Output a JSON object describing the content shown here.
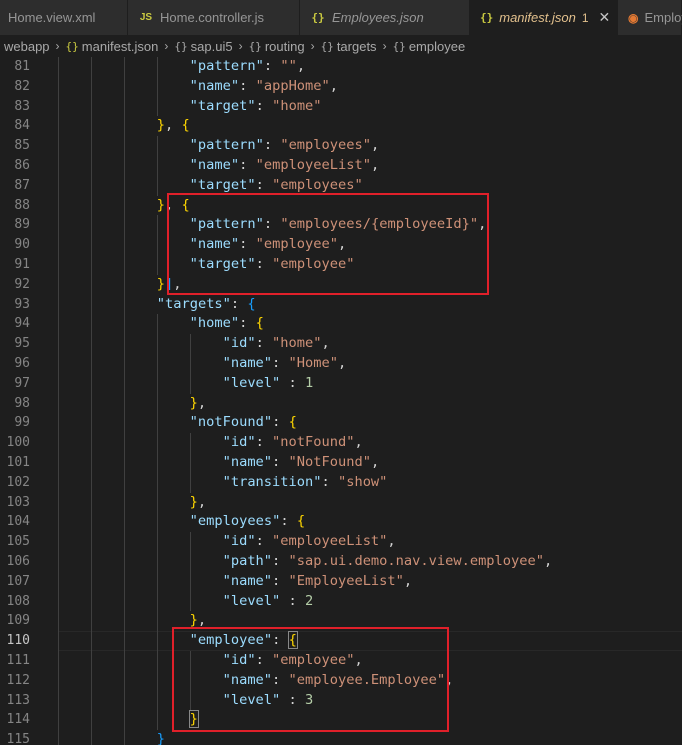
{
  "tabs": [
    {
      "label": "Home.view.xml",
      "icon": "",
      "icon_name": "",
      "active": false,
      "italic": false,
      "badge": "",
      "close": ""
    },
    {
      "label": "Home.controller.js",
      "icon": "JS",
      "icon_name": "js-file-icon",
      "active": false,
      "italic": false,
      "badge": "",
      "close": ""
    },
    {
      "label": "Employees.json",
      "icon": "{}",
      "icon_name": "json-file-icon",
      "active": false,
      "italic": true,
      "badge": "",
      "close": ""
    },
    {
      "label": "manifest.json",
      "icon": "{}",
      "icon_name": "json-file-icon",
      "active": true,
      "italic": true,
      "badge": "1",
      "close": "✕"
    },
    {
      "label": "Employ",
      "icon": "◉",
      "icon_name": "rss-file-icon",
      "active": false,
      "italic": false,
      "badge": "",
      "close": ""
    }
  ],
  "breadcrumb": [
    {
      "label": "webapp",
      "icon": ""
    },
    {
      "label": "manifest.json",
      "icon": "{}"
    },
    {
      "label": "sap.ui5",
      "icon": "{}"
    },
    {
      "label": "routing",
      "icon": "{}"
    },
    {
      "label": "targets",
      "icon": "{}"
    },
    {
      "label": "employee",
      "icon": "{}"
    }
  ],
  "current_line": 110,
  "lines": [
    {
      "n": 81,
      "d": 4,
      "t": [
        [
          "k",
          "\"pattern\""
        ],
        [
          "p",
          ": "
        ],
        [
          "s",
          "\"\""
        ],
        [
          "p",
          ","
        ]
      ]
    },
    {
      "n": 82,
      "d": 4,
      "t": [
        [
          "k",
          "\"name\""
        ],
        [
          "p",
          ": "
        ],
        [
          "s",
          "\"appHome\""
        ],
        [
          "p",
          ","
        ]
      ]
    },
    {
      "n": 83,
      "d": 4,
      "t": [
        [
          "k",
          "\"target\""
        ],
        [
          "p",
          ": "
        ],
        [
          "s",
          "\"home\""
        ]
      ]
    },
    {
      "n": 84,
      "d": 3,
      "t": [
        [
          "b3",
          "}"
        ],
        [
          "p",
          ", "
        ],
        [
          "b3",
          "{"
        ]
      ]
    },
    {
      "n": 85,
      "d": 4,
      "t": [
        [
          "k",
          "\"pattern\""
        ],
        [
          "p",
          ": "
        ],
        [
          "s",
          "\"employees\""
        ],
        [
          "p",
          ","
        ]
      ]
    },
    {
      "n": 86,
      "d": 4,
      "t": [
        [
          "k",
          "\"name\""
        ],
        [
          "p",
          ": "
        ],
        [
          "s",
          "\"employeeList\""
        ],
        [
          "p",
          ","
        ]
      ]
    },
    {
      "n": 87,
      "d": 4,
      "t": [
        [
          "k",
          "\"target\""
        ],
        [
          "p",
          ": "
        ],
        [
          "s",
          "\"employees\""
        ]
      ]
    },
    {
      "n": 88,
      "d": 3,
      "t": [
        [
          "b3",
          "}"
        ],
        [
          "p",
          ", "
        ],
        [
          "b3",
          "{"
        ]
      ]
    },
    {
      "n": 89,
      "d": 4,
      "t": [
        [
          "k",
          "\"pattern\""
        ],
        [
          "p",
          ": "
        ],
        [
          "s",
          "\"employees/{employeeId}\""
        ],
        [
          "p",
          ","
        ]
      ]
    },
    {
      "n": 90,
      "d": 4,
      "t": [
        [
          "k",
          "\"name\""
        ],
        [
          "p",
          ": "
        ],
        [
          "s",
          "\"employee\""
        ],
        [
          "p",
          ","
        ]
      ]
    },
    {
      "n": 91,
      "d": 4,
      "t": [
        [
          "k",
          "\"target\""
        ],
        [
          "p",
          ": "
        ],
        [
          "s",
          "\"employee\""
        ]
      ]
    },
    {
      "n": 92,
      "d": 3,
      "t": [
        [
          "b3",
          "}"
        ],
        [
          "b2",
          "]"
        ],
        [
          "p",
          ","
        ]
      ]
    },
    {
      "n": 93,
      "d": 3,
      "t": [
        [
          "k",
          "\"targets\""
        ],
        [
          "p",
          ": "
        ],
        [
          "b2",
          "{"
        ]
      ]
    },
    {
      "n": 94,
      "d": 4,
      "t": [
        [
          "k",
          "\"home\""
        ],
        [
          "p",
          ": "
        ],
        [
          "b3",
          "{"
        ]
      ]
    },
    {
      "n": 95,
      "d": 5,
      "t": [
        [
          "k",
          "\"id\""
        ],
        [
          "p",
          ": "
        ],
        [
          "s",
          "\"home\""
        ],
        [
          "p",
          ","
        ]
      ]
    },
    {
      "n": 96,
      "d": 5,
      "t": [
        [
          "k",
          "\"name\""
        ],
        [
          "p",
          ": "
        ],
        [
          "s",
          "\"Home\""
        ],
        [
          "p",
          ","
        ]
      ]
    },
    {
      "n": 97,
      "d": 5,
      "t": [
        [
          "k",
          "\"level\""
        ],
        [
          "p",
          " : "
        ],
        [
          "n",
          "1"
        ]
      ]
    },
    {
      "n": 98,
      "d": 4,
      "t": [
        [
          "b3",
          "}"
        ],
        [
          "p",
          ","
        ]
      ]
    },
    {
      "n": 99,
      "d": 4,
      "t": [
        [
          "k",
          "\"notFound\""
        ],
        [
          "p",
          ": "
        ],
        [
          "b3",
          "{"
        ]
      ]
    },
    {
      "n": 100,
      "d": 5,
      "t": [
        [
          "k",
          "\"id\""
        ],
        [
          "p",
          ": "
        ],
        [
          "s",
          "\"notFound\""
        ],
        [
          "p",
          ","
        ]
      ]
    },
    {
      "n": 101,
      "d": 5,
      "t": [
        [
          "k",
          "\"name\""
        ],
        [
          "p",
          ": "
        ],
        [
          "s",
          "\"NotFound\""
        ],
        [
          "p",
          ","
        ]
      ]
    },
    {
      "n": 102,
      "d": 5,
      "t": [
        [
          "k",
          "\"transition\""
        ],
        [
          "p",
          ": "
        ],
        [
          "s",
          "\"show\""
        ]
      ]
    },
    {
      "n": 103,
      "d": 4,
      "t": [
        [
          "b3",
          "}"
        ],
        [
          "p",
          ","
        ]
      ]
    },
    {
      "n": 104,
      "d": 4,
      "t": [
        [
          "k",
          "\"employees\""
        ],
        [
          "p",
          ": "
        ],
        [
          "b3",
          "{"
        ]
      ]
    },
    {
      "n": 105,
      "d": 5,
      "t": [
        [
          "k",
          "\"id\""
        ],
        [
          "p",
          ": "
        ],
        [
          "s",
          "\"employeeList\""
        ],
        [
          "p",
          ","
        ]
      ]
    },
    {
      "n": 106,
      "d": 5,
      "t": [
        [
          "k",
          "\"path\""
        ],
        [
          "p",
          ": "
        ],
        [
          "s",
          "\"sap.ui.demo.nav.view.employee\""
        ],
        [
          "p",
          ","
        ]
      ]
    },
    {
      "n": 107,
      "d": 5,
      "t": [
        [
          "k",
          "\"name\""
        ],
        [
          "p",
          ": "
        ],
        [
          "s",
          "\"EmployeeList\""
        ],
        [
          "p",
          ","
        ]
      ]
    },
    {
      "n": 108,
      "d": 5,
      "t": [
        [
          "k",
          "\"level\""
        ],
        [
          "p",
          " : "
        ],
        [
          "n",
          "2"
        ]
      ]
    },
    {
      "n": 109,
      "d": 4,
      "t": [
        [
          "b3",
          "}"
        ],
        [
          "p",
          ","
        ]
      ]
    },
    {
      "n": 110,
      "d": 4,
      "t": [
        [
          "k",
          "\"employee\""
        ],
        [
          "p",
          ": "
        ],
        [
          "b3m",
          "{"
        ]
      ]
    },
    {
      "n": 111,
      "d": 5,
      "t": [
        [
          "k",
          "\"id\""
        ],
        [
          "p",
          ": "
        ],
        [
          "s",
          "\"employee\""
        ],
        [
          "p",
          ","
        ]
      ]
    },
    {
      "n": 112,
      "d": 5,
      "t": [
        [
          "k",
          "\"name\""
        ],
        [
          "p",
          ": "
        ],
        [
          "s",
          "\"employee.Employee\""
        ],
        [
          "p",
          ","
        ]
      ]
    },
    {
      "n": 113,
      "d": 5,
      "t": [
        [
          "k",
          "\"level\""
        ],
        [
          "p",
          " : "
        ],
        [
          "n",
          "3"
        ]
      ]
    },
    {
      "n": 114,
      "d": 4,
      "t": [
        [
          "b3m",
          "}"
        ]
      ]
    },
    {
      "n": 115,
      "d": 3,
      "t": [
        [
          "b2",
          "}"
        ]
      ]
    }
  ],
  "highlight_color": "#e0202a",
  "colors": {
    "key": "#9cdcfe",
    "string": "#ce9178",
    "number": "#b5cea8",
    "bracket_gold": "#ffd700",
    "bracket_blue": "#179fff",
    "background": "#1e1e1e"
  }
}
